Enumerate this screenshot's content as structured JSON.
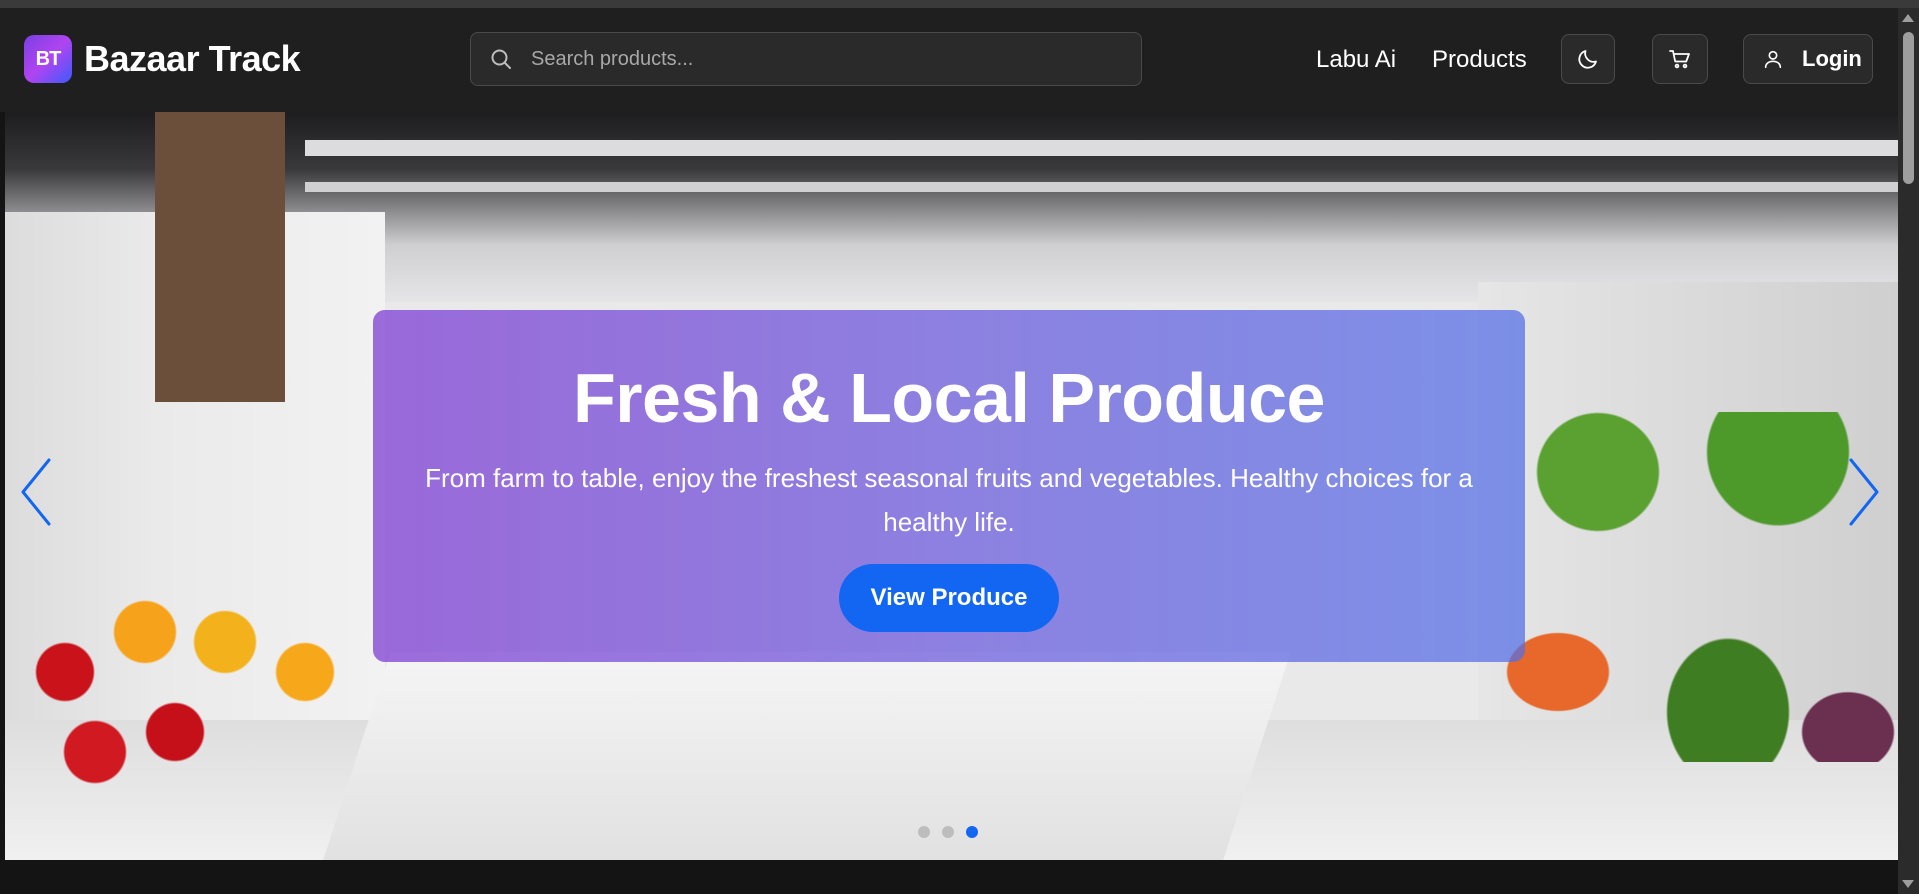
{
  "brand": {
    "logo_text": "BT",
    "name": "Bazaar Track",
    "logo_gradient": [
      "#7b3fe4",
      "#b044f0",
      "#3d5afe"
    ]
  },
  "search": {
    "placeholder": "Search products...",
    "icon": "search-icon"
  },
  "nav": {
    "links": [
      {
        "label": "Labu Ai"
      },
      {
        "label": "Products"
      }
    ],
    "theme_toggle_icon": "moon-icon",
    "cart_icon": "cart-icon",
    "login": {
      "label": "Login",
      "icon": "user-icon"
    }
  },
  "hero": {
    "title": "Fresh & Local Produce",
    "subtitle": "From farm to table, enjoy the freshest seasonal fruits and vegetables. Healthy choices for a healthy life.",
    "cta_label": "View Produce",
    "prev_icon": "chevron-left-icon",
    "next_icon": "chevron-right-icon",
    "slides": 3,
    "active_slide": 3
  },
  "colors": {
    "accent": "#1266f1",
    "navbar_bg": "#1f1f1f",
    "page_bg": "#141414"
  }
}
